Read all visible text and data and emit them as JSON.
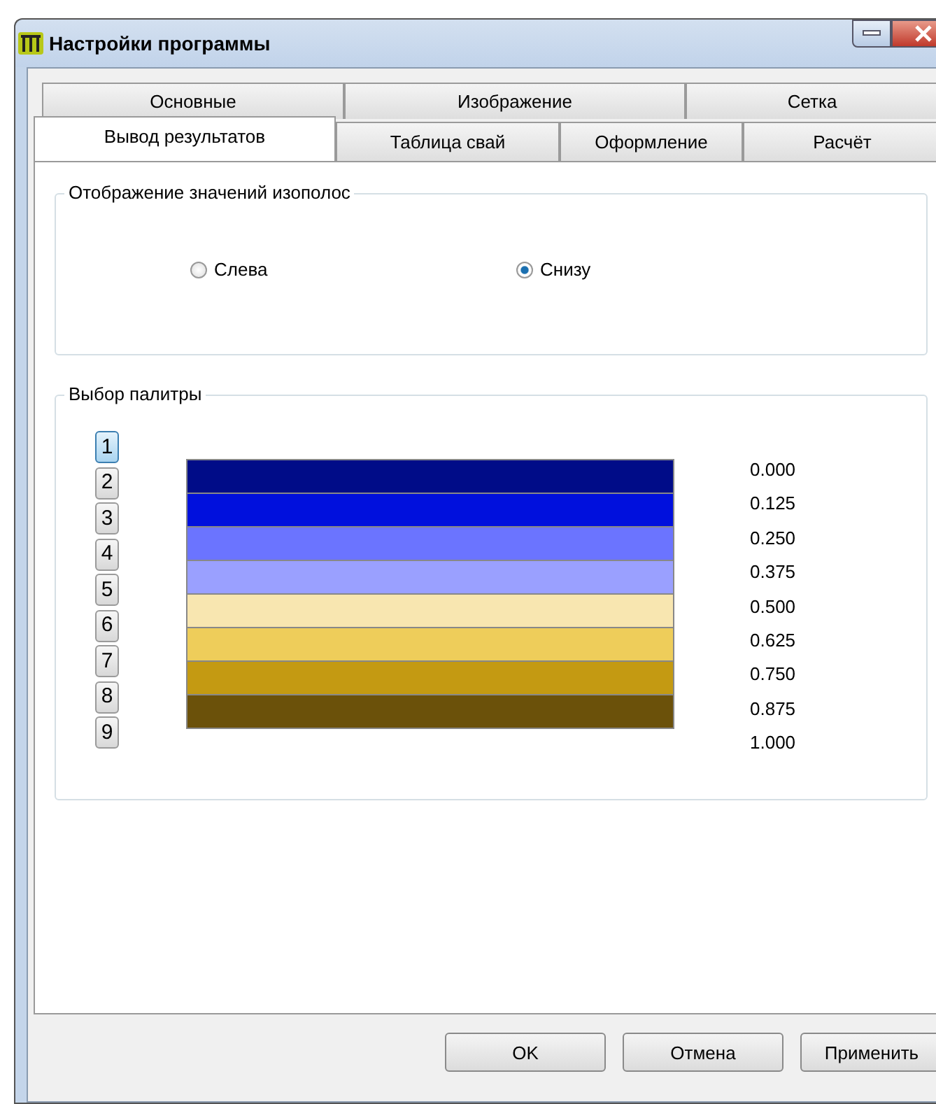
{
  "window": {
    "title": "Настройки программы"
  },
  "tabs": [
    [
      {
        "label": "Основные",
        "selected": false
      },
      {
        "label": "Изображение",
        "selected": false
      },
      {
        "label": "Сетка",
        "selected": false
      }
    ],
    [
      {
        "label": "Вывод результатов",
        "selected": true
      },
      {
        "label": "Таблица свай",
        "selected": false
      },
      {
        "label": "Оформление",
        "selected": false
      },
      {
        "label": "Расчёт",
        "selected": false
      }
    ]
  ],
  "isoband_group": {
    "title": "Отображение значений изополос",
    "options": [
      {
        "label": "Слева",
        "selected": false
      },
      {
        "label": "Снизу",
        "selected": true
      }
    ]
  },
  "palette_group": {
    "title": "Выбор палитры",
    "palettes": [
      {
        "label": "1",
        "selected": true
      },
      {
        "label": "2",
        "selected": false
      },
      {
        "label": "3",
        "selected": false
      },
      {
        "label": "4",
        "selected": false
      },
      {
        "label": "5",
        "selected": false
      },
      {
        "label": "6",
        "selected": false
      },
      {
        "label": "7",
        "selected": false
      },
      {
        "label": "8",
        "selected": false
      },
      {
        "label": "9",
        "selected": false
      }
    ],
    "bands": [
      {
        "color": "#000c88"
      },
      {
        "color": "#0010dd"
      },
      {
        "color": "#6b74ff"
      },
      {
        "color": "#9aa0ff"
      },
      {
        "color": "#f8e6b0"
      },
      {
        "color": "#eecd5a"
      },
      {
        "color": "#c49a12"
      },
      {
        "color": "#6b510a"
      }
    ],
    "values": [
      "0.000",
      "0.125",
      "0.250",
      "0.375",
      "0.500",
      "0.625",
      "0.750",
      "0.875",
      "1.000"
    ]
  },
  "buttons": [
    "OK",
    "Отмена",
    "Применить"
  ]
}
